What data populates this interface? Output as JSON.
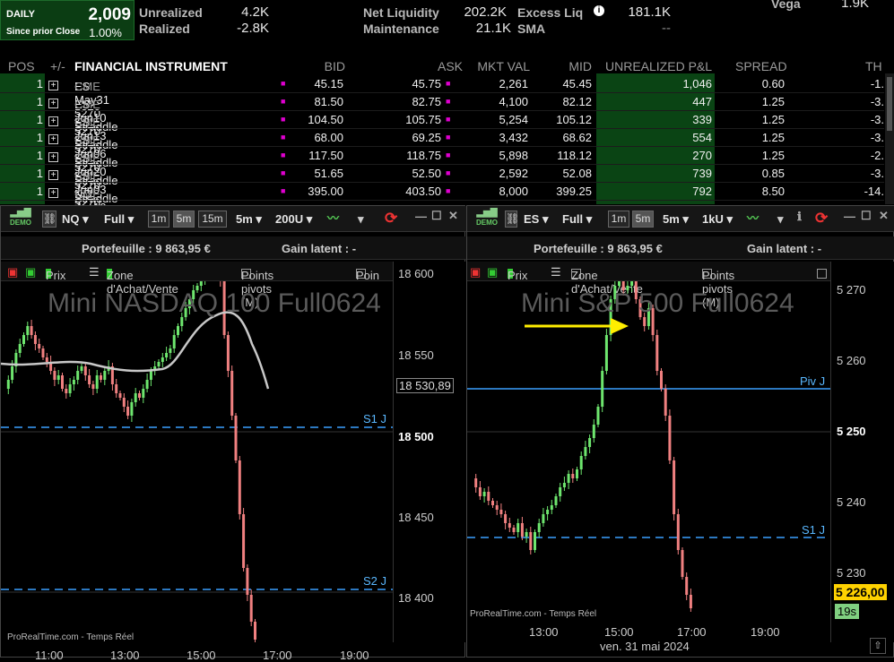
{
  "summary": {
    "daily_label": "DAILY",
    "daily_value": "2,009",
    "since_label": "Since prior Close",
    "since_pct": "1.00%",
    "unrealized_label": "Unrealized",
    "unrealized": "4.2K",
    "realized_label": "Realized",
    "realized": "-2.8K",
    "netliq_label": "Net Liquidity",
    "netliq": "202.2K",
    "maint_label": "Maintenance",
    "maint": "21.1K",
    "excess_label": "Excess Liq",
    "excess": "181.1K",
    "sma_label": "SMA",
    "sma": "--",
    "vega_label": "Vega",
    "vega": "1.9K"
  },
  "table": {
    "headers": {
      "pos": "POS",
      "pm": "+/-",
      "instr": "FINANCIAL INSTRUMENT",
      "bid": "BID",
      "ask": "ASK",
      "mkt": "MKT VAL",
      "mid": "MID",
      "unr": "UNREALIZED P&L",
      "spread": "SPREAD",
      "th": "TH"
    },
    "rows": [
      {
        "pos": "1",
        "name": "ES May31 5270 Straddle",
        "ex": "CME",
        "bid": "45.15",
        "ask": "45.75",
        "mkt": "2,261",
        "mid": "45.45",
        "unr": "1,046",
        "spread": "0.60",
        "th": "-1."
      },
      {
        "pos": "1",
        "name": "ES Jun10 5270 Straddle",
        "ex": "CME",
        "bid": "81.50",
        "ask": "82.75",
        "mkt": "4,100",
        "mid": "82.12",
        "unr": "447",
        "spread": "1.25",
        "th": "-3."
      },
      {
        "pos": "1",
        "name": "ES Jun13 5270 Straddle",
        "ex": "CME",
        "bid": "104.50",
        "ask": "105.75",
        "mkt": "5,254",
        "mid": "105.12",
        "unr": "339",
        "spread": "1.25",
        "th": "-3."
      },
      {
        "pos": "1",
        "name": "ES Jun06 5270 Straddle",
        "ex": "CME",
        "bid": "68.00",
        "ask": "69.25",
        "mkt": "3,432",
        "mid": "68.62",
        "unr": "554",
        "spread": "1.25",
        "th": "-3."
      },
      {
        "pos": "1",
        "name": "ES Jun20 5270 Straddle",
        "ex": "CME",
        "bid": "117.50",
        "ask": "118.75",
        "mkt": "5,898",
        "mid": "118.12",
        "unr": "270",
        "spread": "1.25",
        "th": "-2."
      },
      {
        "pos": "1",
        "name": "ES Jun03 5270 Straddle",
        "ex": "CME",
        "bid": "51.65",
        "ask": "52.50",
        "mkt": "2,592",
        "mid": "52.08",
        "unr": "739",
        "spread": "0.85",
        "th": "-3."
      },
      {
        "pos": "1",
        "name": "NQ Jun10 18600 Straddle",
        "ex": "CME",
        "bid": "395.00",
        "ask": "403.50",
        "mkt": "8,000",
        "mid": "399.25",
        "unr": "792",
        "spread": "8.50",
        "th": "-14."
      }
    ]
  },
  "left_chart": {
    "demo": "DEMO",
    "symbol": "NQ",
    "view": "Full",
    "tf1": "1m",
    "tf2": "5m",
    "tf3": "15m",
    "interval": "5m",
    "units": "200U",
    "portfolio": "Portefeuille : 9 863,95 €",
    "gain": "Gain latent : -",
    "ind1": "Prix",
    "ind2": "Zone d'Achat/Vente",
    "ind3": "Points pivots (M)",
    "ind4": "Poin",
    "watermark": "Mini NASDAQ 100 Full0624",
    "source": "ProRealTime.com - Temps Réel",
    "yticks": [
      "18 600",
      "18 550",
      "18 530,89",
      "18 500",
      "18 450",
      "18 400"
    ],
    "xticks": [
      "11:00",
      "13:00",
      "15:00",
      "17:00",
      "19:00"
    ],
    "levels": [
      "S1 J",
      "S2 J"
    ]
  },
  "right_chart": {
    "demo": "DEMO",
    "symbol": "ES",
    "view": "Full",
    "tf1": "1m",
    "tf2": "5m",
    "interval": "5m",
    "units": "1kU",
    "portfolio": "Portefeuille : 9 863,95 €",
    "gain": "Gain latent : -",
    "ind1": "Prix",
    "ind2": "Zone d'Achat/Vente",
    "ind3": "Points pivots (M)",
    "watermark": "Mini S&P 500 Full0624",
    "source": "ProRealTime.com - Temps Réel",
    "yticks": [
      "5 270",
      "5 260",
      "5 250",
      "5 240",
      "5 230"
    ],
    "price": "5 226,00",
    "timer": "19s",
    "xticks": [
      "13:00",
      "15:00",
      "17:00",
      "19:00"
    ],
    "date": "ven. 31 mai 2024",
    "levels": [
      "Piv J",
      "S1 J"
    ]
  },
  "colors": {
    "up": "#6ee66e",
    "down": "#f08080",
    "pivot": "#3aa0ff",
    "pos_bg": "#0a4414",
    "price_tag": "#ffd200"
  }
}
